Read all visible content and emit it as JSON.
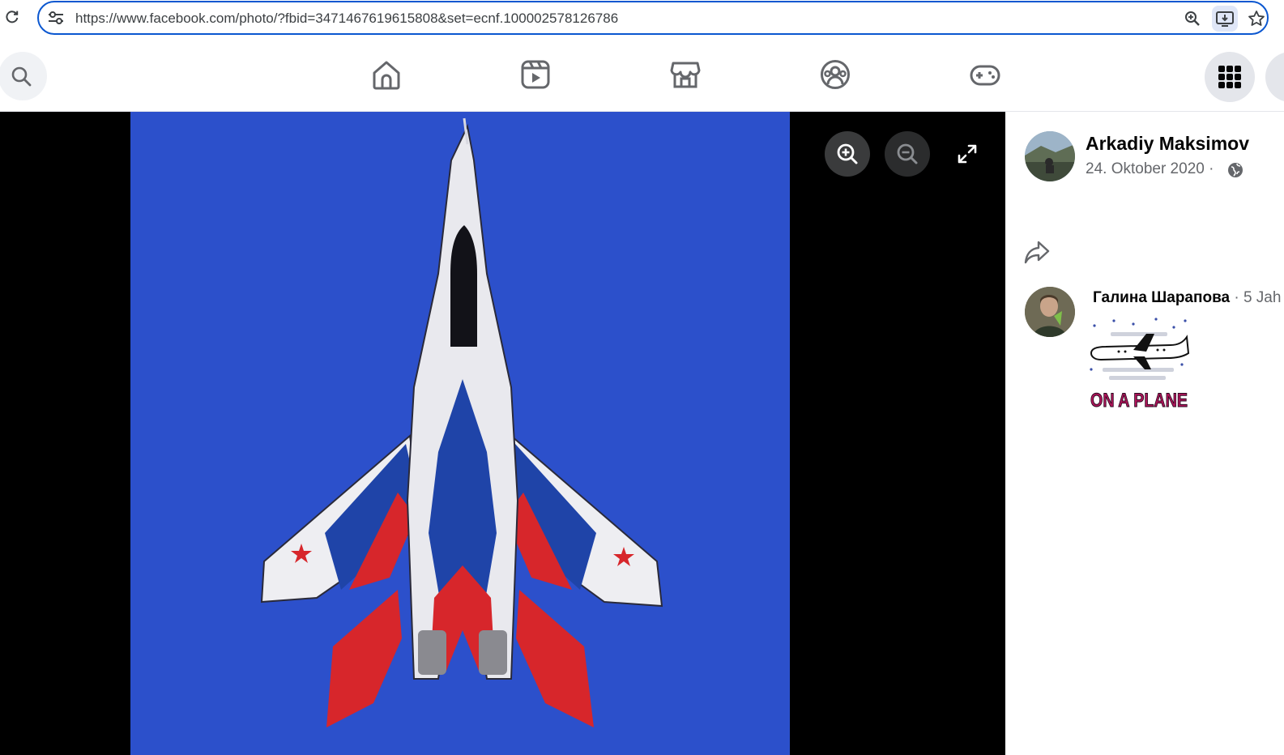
{
  "browser": {
    "url": "https://www.facebook.com/photo/?fbid=3471467619615808&set=ecnf.100002578126786",
    "icons": [
      "reload-icon",
      "site-info-icon",
      "zoom-icon",
      "install-app-icon",
      "star-icon"
    ]
  },
  "fb_nav": {
    "tabs": [
      "home",
      "video",
      "marketplace",
      "groups",
      "gaming"
    ],
    "icons": [
      "search-icon",
      "home-icon",
      "video-icon",
      "marketplace-icon",
      "groups-icon",
      "gaming-icon",
      "menu-grid-icon"
    ]
  },
  "viewer": {
    "photo_alt": "",
    "controls": [
      "zoom-in-icon",
      "zoom-out-icon",
      "fullscreen-icon"
    ]
  },
  "post": {
    "author": "Arkadiy Maksimov",
    "date": "24. Oktober 2020",
    "separator": "·",
    "privacy_icon": "globe-icon"
  },
  "comment": {
    "author": "Галина Шарапова",
    "time": "· 5 Jah",
    "sticker_text": "ON A PLANE"
  },
  "colors": {
    "accent": "#0b57d0",
    "sky": "#2b4fc9",
    "panel_text": "#050505",
    "muted_text": "#65676b",
    "sticker_text": "#b0155a"
  }
}
